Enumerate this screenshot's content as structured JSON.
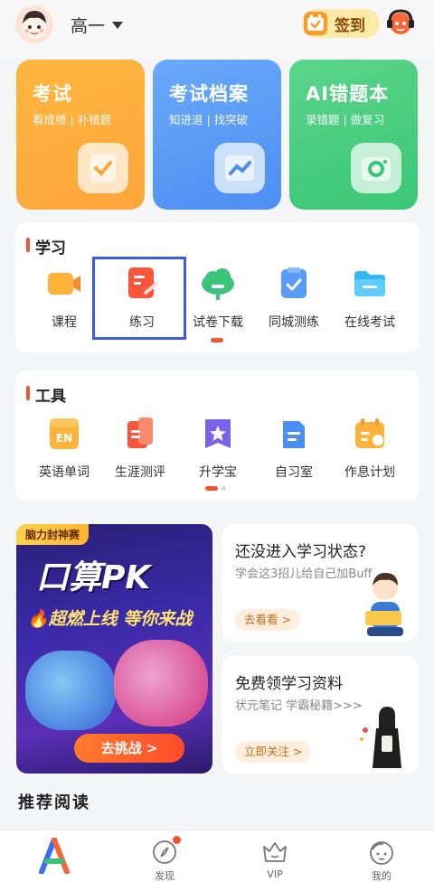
{
  "header": {
    "grade": "高一",
    "signin_label": "签到"
  },
  "cards": [
    {
      "title": "考试",
      "subtitle": "看成绩 | 补错题"
    },
    {
      "title": "考试档案",
      "subtitle": "知进退 | 找突破"
    },
    {
      "title": "AI错题本",
      "subtitle": "录错题 | 做复习"
    }
  ],
  "study": {
    "title": "学习",
    "items": [
      {
        "label": "课程",
        "icon": "video-icon"
      },
      {
        "label": "练习",
        "icon": "document-icon"
      },
      {
        "label": "试卷下载",
        "icon": "cloud-download-icon"
      },
      {
        "label": "同城测练",
        "icon": "clipboard-check-icon"
      },
      {
        "label": "在线考试",
        "icon": "folder-icon"
      }
    ]
  },
  "tools": {
    "title": "工具",
    "items": [
      {
        "label": "英语单词",
        "icon": "en-book-icon",
        "icon_text": "EN"
      },
      {
        "label": "生涯测评",
        "icon": "career-icon"
      },
      {
        "label": "升学宝",
        "icon": "star-flag-icon"
      },
      {
        "label": "自习室",
        "icon": "desk-icon"
      },
      {
        "label": "作息计划",
        "icon": "calendar-icon"
      }
    ]
  },
  "banner": {
    "tag": "脑力封神赛",
    "headline": "口算PK",
    "slogan": "🔥超燃上线 等你来战",
    "button": "去挑战 >"
  },
  "promos": [
    {
      "title": "还没进入学习状态?",
      "subtitle": "学会这3招儿给自己加Buff",
      "button": "去看看 >"
    },
    {
      "title": "免费领学习资料",
      "subtitle": "状元笔记 学霸秘籍>>>",
      "button": "立即关注 >"
    }
  ],
  "recommend_title": "推荐阅读",
  "tabbar": [
    {
      "label": "",
      "icon": "home-logo-icon"
    },
    {
      "label": "发现",
      "icon": "compass-icon"
    },
    {
      "label": "VIP",
      "icon": "crown-icon"
    },
    {
      "label": "我的",
      "icon": "profile-face-icon"
    }
  ],
  "colors": {
    "accent": "#f55330",
    "card_orange": "#fda53a",
    "card_blue": "#4c8ff3",
    "card_green": "#3bc675",
    "highlight": "#3d5ce6"
  }
}
